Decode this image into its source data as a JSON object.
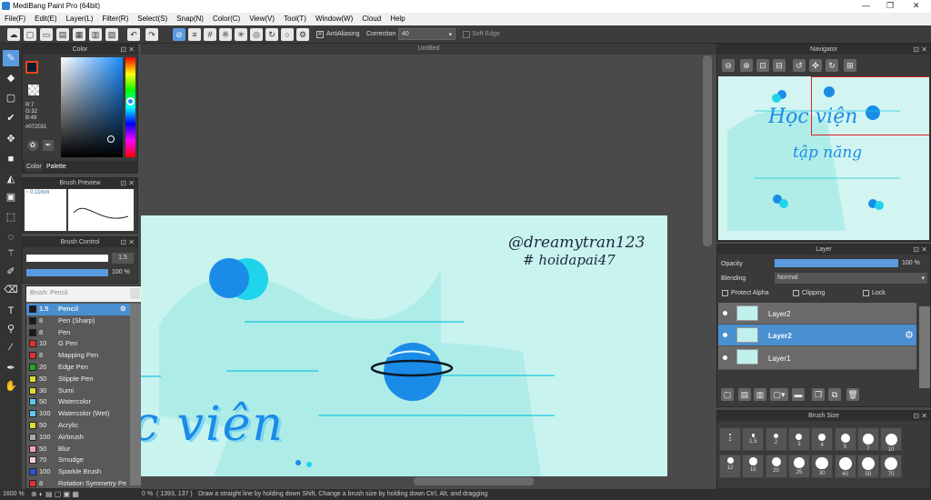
{
  "app": {
    "title": "MediBang Paint Pro (64bit)"
  },
  "menu": [
    "File(F)",
    "Edit(E)",
    "Layer(L)",
    "Filter(R)",
    "Select(S)",
    "Snap(N)",
    "Color(C)",
    "View(V)",
    "Tool(T)",
    "Window(W)",
    "Cloud",
    "Help"
  ],
  "toolbar": {
    "antialias": "AntiAliasing",
    "correction_label": "Correction",
    "correction_value": "40",
    "soft_edge": "Soft Edge"
  },
  "color_panel": {
    "title": "Color",
    "r": "R:7",
    "g": "G:32",
    "b": "B:49",
    "hex": "#072031",
    "tab_color": "Color",
    "tab_palette": "Palette",
    "primary": "#072031",
    "accent": "#e8451b"
  },
  "brush_preview": {
    "title": "Brush Preview",
    "size": "0.11mm"
  },
  "brush_control": {
    "title": "Brush Control",
    "size_value": "1.5",
    "opacity_value": "100 %"
  },
  "brush_list": {
    "title": "Brush: Pencil",
    "items": [
      {
        "size": "1.5",
        "name": "Pencil",
        "color": "#1a1a1a"
      },
      {
        "size": "8",
        "name": "Pen (Sharp)",
        "color": "#1a1a1a"
      },
      {
        "size": "8",
        "name": "Pen",
        "color": "#1a1a1a"
      },
      {
        "size": "10",
        "name": "G Pen",
        "color": "#d33"
      },
      {
        "size": "8",
        "name": "Mapping Pen",
        "color": "#d33"
      },
      {
        "size": "20",
        "name": "Edge Pen",
        "color": "#2a2"
      },
      {
        "size": "50",
        "name": "Stipple Pen",
        "color": "#dd3"
      },
      {
        "size": "30",
        "name": "Sumi",
        "color": "#dd3"
      },
      {
        "size": "50",
        "name": "Watercolor",
        "color": "#5bc8f0"
      },
      {
        "size": "100",
        "name": "Watercolor (Wet)",
        "color": "#5bc8f0"
      },
      {
        "size": "50",
        "name": "Acrylic",
        "color": "#dd3"
      },
      {
        "size": "100",
        "name": "Airbrush",
        "color": "#aaa"
      },
      {
        "size": "50",
        "name": "Blur",
        "color": "#f5a0c8"
      },
      {
        "size": "70",
        "name": "Smudge",
        "color": "#f5d0d0"
      },
      {
        "size": "100",
        "name": "Sparkle Brush",
        "color": "#3355dd"
      },
      {
        "size": "8",
        "name": "Rotation Symmetry Pe",
        "color": "#d33"
      }
    ]
  },
  "document": {
    "tab": "Untitled",
    "signature1": "@dreamytran123",
    "signature2": "# hoidapai47",
    "art_text": "c viên"
  },
  "navigator": {
    "title": "Navigator",
    "text1": "Học viện",
    "text2": "tập năng"
  },
  "layer_panel": {
    "title": "Layer",
    "opacity_label": "Opacity",
    "opacity_value": "100 %",
    "blending_label": "Blending",
    "blending_value": "Normal",
    "protect_alpha": "Protect Alpha",
    "clipping": "Clipping",
    "lock": "Lock",
    "layers": [
      {
        "name": "Layer2"
      },
      {
        "name": "Layer2"
      },
      {
        "name": "Layer1"
      }
    ]
  },
  "brush_size": {
    "title": "Brush Size",
    "row1": [
      "1",
      "1.5",
      "2",
      "3",
      "4",
      "5",
      "7",
      "10"
    ],
    "row2": [
      "12",
      "15",
      "20",
      "25",
      "30",
      "40",
      "50",
      "70"
    ]
  },
  "status": {
    "zoom": "1600 %",
    "zoom2": "0 %",
    "coords": "( 1393, 137 )",
    "hint": "Draw a straight line by holding down Shift, Change a brush size by holding down Ctrl, Alt, and dragging"
  }
}
